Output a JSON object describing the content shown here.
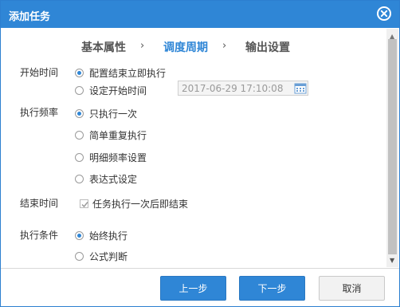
{
  "dialog": {
    "title": "添加任务",
    "close_icon": "close-circle-icon"
  },
  "steps": {
    "items": [
      "基本属性",
      "调度周期",
      "输出设置"
    ],
    "separator": "›",
    "active_index": 1
  },
  "form": {
    "start_time": {
      "label": "开始时间",
      "options": [
        {
          "label": "配置结束立即执行",
          "selected": true
        },
        {
          "label": "设定开始时间",
          "selected": false
        }
      ],
      "datetime_value": "2017-06-29 17:10:08",
      "calendar_icon": "calendar-icon"
    },
    "frequency": {
      "label": "执行频率",
      "options": [
        {
          "label": "只执行一次",
          "selected": true
        },
        {
          "label": "简单重复执行",
          "selected": false
        },
        {
          "label": "明细频率设置",
          "selected": false
        },
        {
          "label": "表达式设定",
          "selected": false
        }
      ]
    },
    "end_time": {
      "label": "结束时间",
      "checkbox_label": "任务执行一次后即结束",
      "checked": true
    },
    "condition": {
      "label": "执行条件",
      "options": [
        {
          "label": "始终执行",
          "selected": true
        },
        {
          "label": "公式判断",
          "selected": false
        }
      ]
    }
  },
  "footer": {
    "prev": "上一步",
    "next": "下一步",
    "cancel": "取消"
  },
  "colors": {
    "accent": "#2f86d6"
  }
}
